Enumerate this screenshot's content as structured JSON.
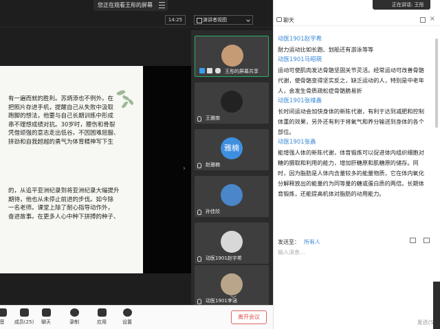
{
  "banner": {
    "viewing_text": "您正在观看王彤的屏幕",
    "speaker_text": "正在讲话: 王彤"
  },
  "topbar": {
    "time": "14:25",
    "view_mode": "演讲者视图"
  },
  "slide": {
    "para1": "有一遍而就的胜利。苏炳添也不例外。在\n把照片存进手机，提醒自己从失败中汲取\n跑脚的想法，他要与自己长期训练中形成\n串不理想成绩对抗。30岁时，腰伤和骨裂\n凭借顽强的意志走出低谷。不因困难屈服、\n拼劲和自我超越的勇气为体育精神写下生",
    "para2": "的，从追平亚洲纪录到将亚洲纪录大幅提升\n期待，他也从未停止前进的步伐。如今除\n一名老师。课堂上除了耐心指导动作外，\n奋进故事。在更多人心中种下拼搏的种子、"
  },
  "video_tiles": [
    {
      "name": "王彤的屏幕共享",
      "active": true
    },
    {
      "name": "王雅南",
      "active": false
    },
    {
      "name": "赵雅楠",
      "avatar_text": "雅楠",
      "active": false
    },
    {
      "name": "孙佳欣",
      "active": false
    },
    {
      "name": "动医1901赵宇希",
      "active": false
    },
    {
      "name": "动医1901李涵",
      "active": false
    }
  ],
  "toolbar": {
    "items": [
      {
        "label": "音"
      },
      {
        "label": "成员(25)"
      },
      {
        "label": "聊天"
      },
      {
        "label": "录制"
      },
      {
        "label": "应用"
      },
      {
        "label": "设置"
      }
    ],
    "leave_label": "离开会议"
  },
  "chat": {
    "title": "聊天",
    "messages": [
      {
        "sender": "动医1901赵宇希",
        "body": "耐力运动比如长跑、划船还有游泳等等"
      },
      {
        "sender": "动医1901马昭萌",
        "body": "运动可使肌肉发达骨骼坚固关节灵活。经常运动可改善骨骼代谢，使骨骼变得坚实反之，缺乏运动的人，特别是中老年人，会发生骨质疏松症骨骼脆易折"
      },
      {
        "sender": "动医1901张维鑫",
        "body": "长时间运动会加快身体的新陈代谢，有利于达到减肥和控制体重的效果，另外还有利于将氧气和养分输送到身体的各个部位。"
      },
      {
        "sender": "动医1901张鑫",
        "body": "能增强人体的新陈代谢，体育锻炼可以促进体内组织细胞对糖的摄取和利用的能力，增加肝糖原和肌糖原的储存。同时，因为脂肪是人体内含量较多的能量物质，它在体内氧化分解释放出的能量约为同等量的糖或蛋白质的两倍。长期体育锻炼，还能提高机体对脂肪的动用能力。"
      }
    ],
    "send_to_label": "发送至：",
    "send_to_target": "所有人",
    "input_placeholder": "输入消息...",
    "send_label": "发送(S)"
  }
}
